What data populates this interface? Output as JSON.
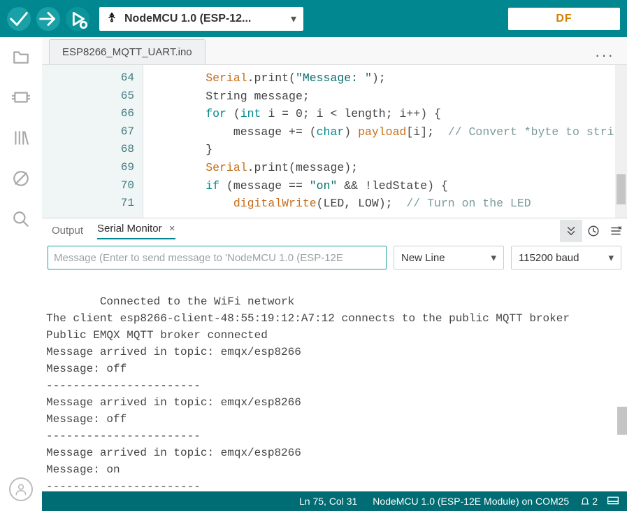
{
  "topbar": {
    "board_label": "NodeMCU 1.0 (ESP-12...",
    "logo_text": "DF"
  },
  "tab": {
    "filename": "ESP8266_MQTT_UART.ino"
  },
  "editor": {
    "gutter": [
      "64",
      "65",
      "66",
      "67",
      "68",
      "69",
      "70",
      "71"
    ],
    "lines": [
      {
        "indent": "        ",
        "seg": [
          {
            "t": "Serial",
            "c": "tk-fn"
          },
          {
            "t": ".print("
          },
          {
            "t": "\"Message: \"",
            "c": "tk-str"
          },
          {
            "t": ");"
          }
        ]
      },
      {
        "indent": "        ",
        "seg": [
          {
            "t": "String message;"
          }
        ]
      },
      {
        "indent": "        ",
        "seg": [
          {
            "t": "for",
            "c": "tk-kw"
          },
          {
            "t": " ("
          },
          {
            "t": "int",
            "c": "tk-kw"
          },
          {
            "t": " i = 0; i < length; i++) {"
          }
        ]
      },
      {
        "indent": "            ",
        "seg": [
          {
            "t": "message += ("
          },
          {
            "t": "char",
            "c": "tk-kw"
          },
          {
            "t": ") "
          },
          {
            "t": "payload",
            "c": "tk-fn"
          },
          {
            "t": "[i];  "
          },
          {
            "t": "// Convert *byte to string",
            "c": "tk-cmt"
          }
        ]
      },
      {
        "indent": "        ",
        "seg": [
          {
            "t": "}"
          }
        ]
      },
      {
        "indent": "        ",
        "seg": [
          {
            "t": "Serial",
            "c": "tk-fn"
          },
          {
            "t": ".print(message);"
          }
        ]
      },
      {
        "indent": "        ",
        "seg": [
          {
            "t": "if",
            "c": "tk-kw"
          },
          {
            "t": " (message == "
          },
          {
            "t": "\"on\"",
            "c": "tk-str"
          },
          {
            "t": " && !ledState) {"
          }
        ]
      },
      {
        "indent": "            ",
        "seg": [
          {
            "t": "digitalWrite",
            "c": "tk-fn"
          },
          {
            "t": "(LED, LOW);  "
          },
          {
            "t": "// Turn on the LED",
            "c": "tk-cmt"
          }
        ]
      }
    ]
  },
  "panel": {
    "output_tab": "Output",
    "serial_tab": "Serial Monitor"
  },
  "serial": {
    "placeholder": "Message (Enter to send message to 'NodeMCU 1.0 (ESP-12E",
    "line_ending": "New Line",
    "baud": "115200 baud",
    "log": "Connected to the WiFi network\nThe client esp8266-client-48:55:19:12:A7:12 connects to the public MQTT broker\nPublic EMQX MQTT broker connected\nMessage arrived in topic: emqx/esp8266\nMessage: off\n-----------------------\nMessage arrived in topic: emqx/esp8266\nMessage: off\n-----------------------\nMessage arrived in topic: emqx/esp8266\nMessage: on\n-----------------------"
  },
  "statusbar": {
    "position": "Ln 75, Col 31",
    "board": "NodeMCU 1.0 (ESP-12E Module) on COM25",
    "notify_count": "2"
  }
}
